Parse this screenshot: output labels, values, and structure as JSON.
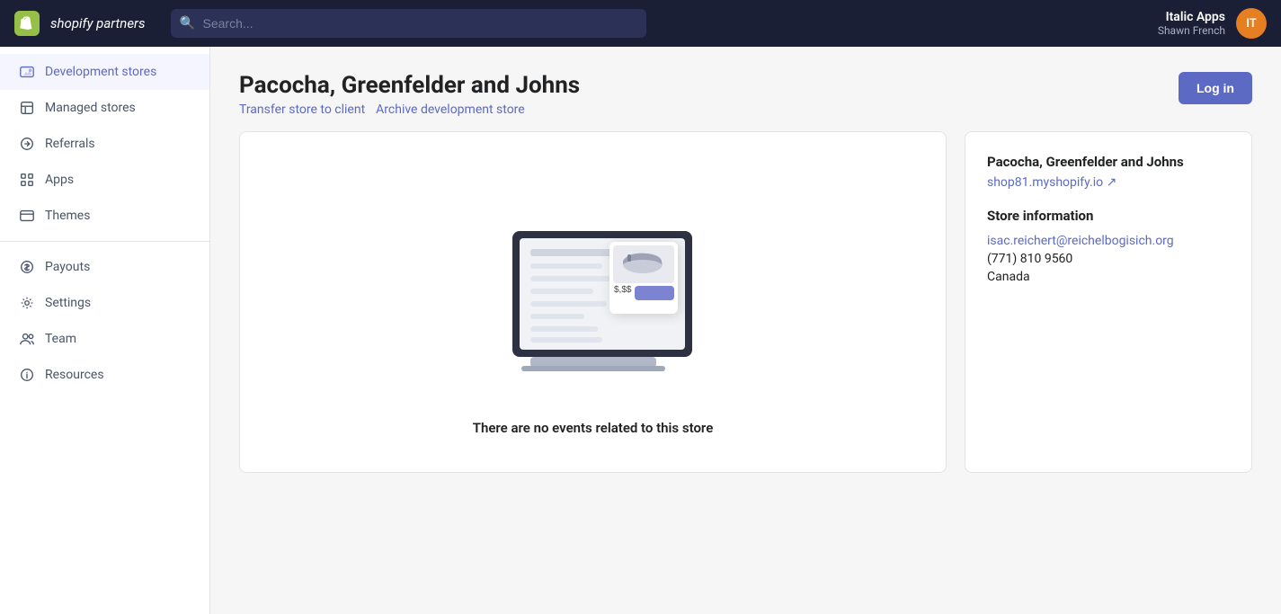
{
  "topnav": {
    "logo_text": "shopify partners",
    "search_placeholder": "Search...",
    "user_initials": "IT",
    "user_company": "Italic Apps",
    "user_name": "Shawn French",
    "user_avatar_color": "#e67e22"
  },
  "sidebar": {
    "items": [
      {
        "id": "development-stores",
        "label": "Development stores",
        "active": true
      },
      {
        "id": "managed-stores",
        "label": "Managed stores",
        "active": false
      },
      {
        "id": "referrals",
        "label": "Referrals",
        "active": false
      },
      {
        "id": "apps",
        "label": "Apps",
        "active": false
      },
      {
        "id": "themes",
        "label": "Themes",
        "active": false
      },
      {
        "id": "payouts",
        "label": "Payouts",
        "active": false
      },
      {
        "id": "settings",
        "label": "Settings",
        "active": false
      },
      {
        "id": "team",
        "label": "Team",
        "active": false
      },
      {
        "id": "resources",
        "label": "Resources",
        "active": false
      }
    ]
  },
  "main": {
    "page_title": "Pacocha, Greenfelder and Johns",
    "transfer_link": "Transfer store to client",
    "archive_link": "Archive development store",
    "log_in_label": "Log in",
    "empty_state_text": "There are no events related to this store",
    "info_card": {
      "store_name": "Pacocha, Greenfelder and Johns",
      "store_url": "shop81.myshopify.io",
      "store_url_display": "shop81.myshopify.io ↗",
      "section_title": "Store information",
      "email": "isac.reichert@reichelbogisich.org",
      "phone": "(771) 810 9560",
      "country": "Canada"
    }
  }
}
